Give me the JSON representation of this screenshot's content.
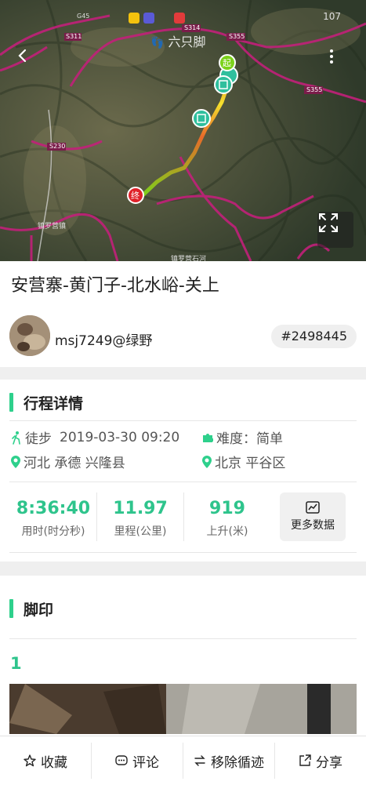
{
  "map": {
    "watermark": "六只脚",
    "road_labels": [
      "S311",
      "S355",
      "S314",
      "S230",
      "S355",
      "G45"
    ],
    "places": [
      "镇罗营镇",
      "镇罗营石河"
    ],
    "start_marker": "起",
    "end_marker": "终",
    "status": {
      "battery": "107"
    }
  },
  "trip": {
    "title": "安营寨-黄门子-北水峪-关上",
    "author": "msj7249@绿野",
    "id": "#2498445"
  },
  "details": {
    "heading": "行程详情",
    "activity": "徒步",
    "datetime": "2019-03-30 09:20",
    "difficulty": "难度：简单",
    "start_place": "河北 承德 兴隆县",
    "end_place": "北京 平谷区"
  },
  "stats": [
    {
      "value": "8:36:40",
      "label": "用时(时分秒)"
    },
    {
      "value": "11.97",
      "label": "里程(公里)"
    },
    {
      "value": "919",
      "label": "上升(米)"
    }
  ],
  "more_data": "更多数据",
  "footprint": {
    "heading": "脚印",
    "index": "1"
  },
  "tabbar": {
    "favorite": "收藏",
    "comment": "评论",
    "remove_loop": "移除循迹",
    "share": "分享"
  },
  "colors": {
    "accent": "#2ed08c",
    "stat_text": "#2ec48c",
    "route_start": "#e86a2a",
    "route_end": "#7bd21b",
    "end_marker": "#e0222a",
    "road": "#c2207a"
  },
  "icons": [
    "back-arrow-icon",
    "more-vert-icon",
    "fullscreen-icon",
    "hiker-icon",
    "puzzle-icon",
    "start-pin-icon",
    "end-pin-icon",
    "chart-icon",
    "star-icon",
    "comment-icon",
    "swap-icon",
    "share-icon"
  ]
}
